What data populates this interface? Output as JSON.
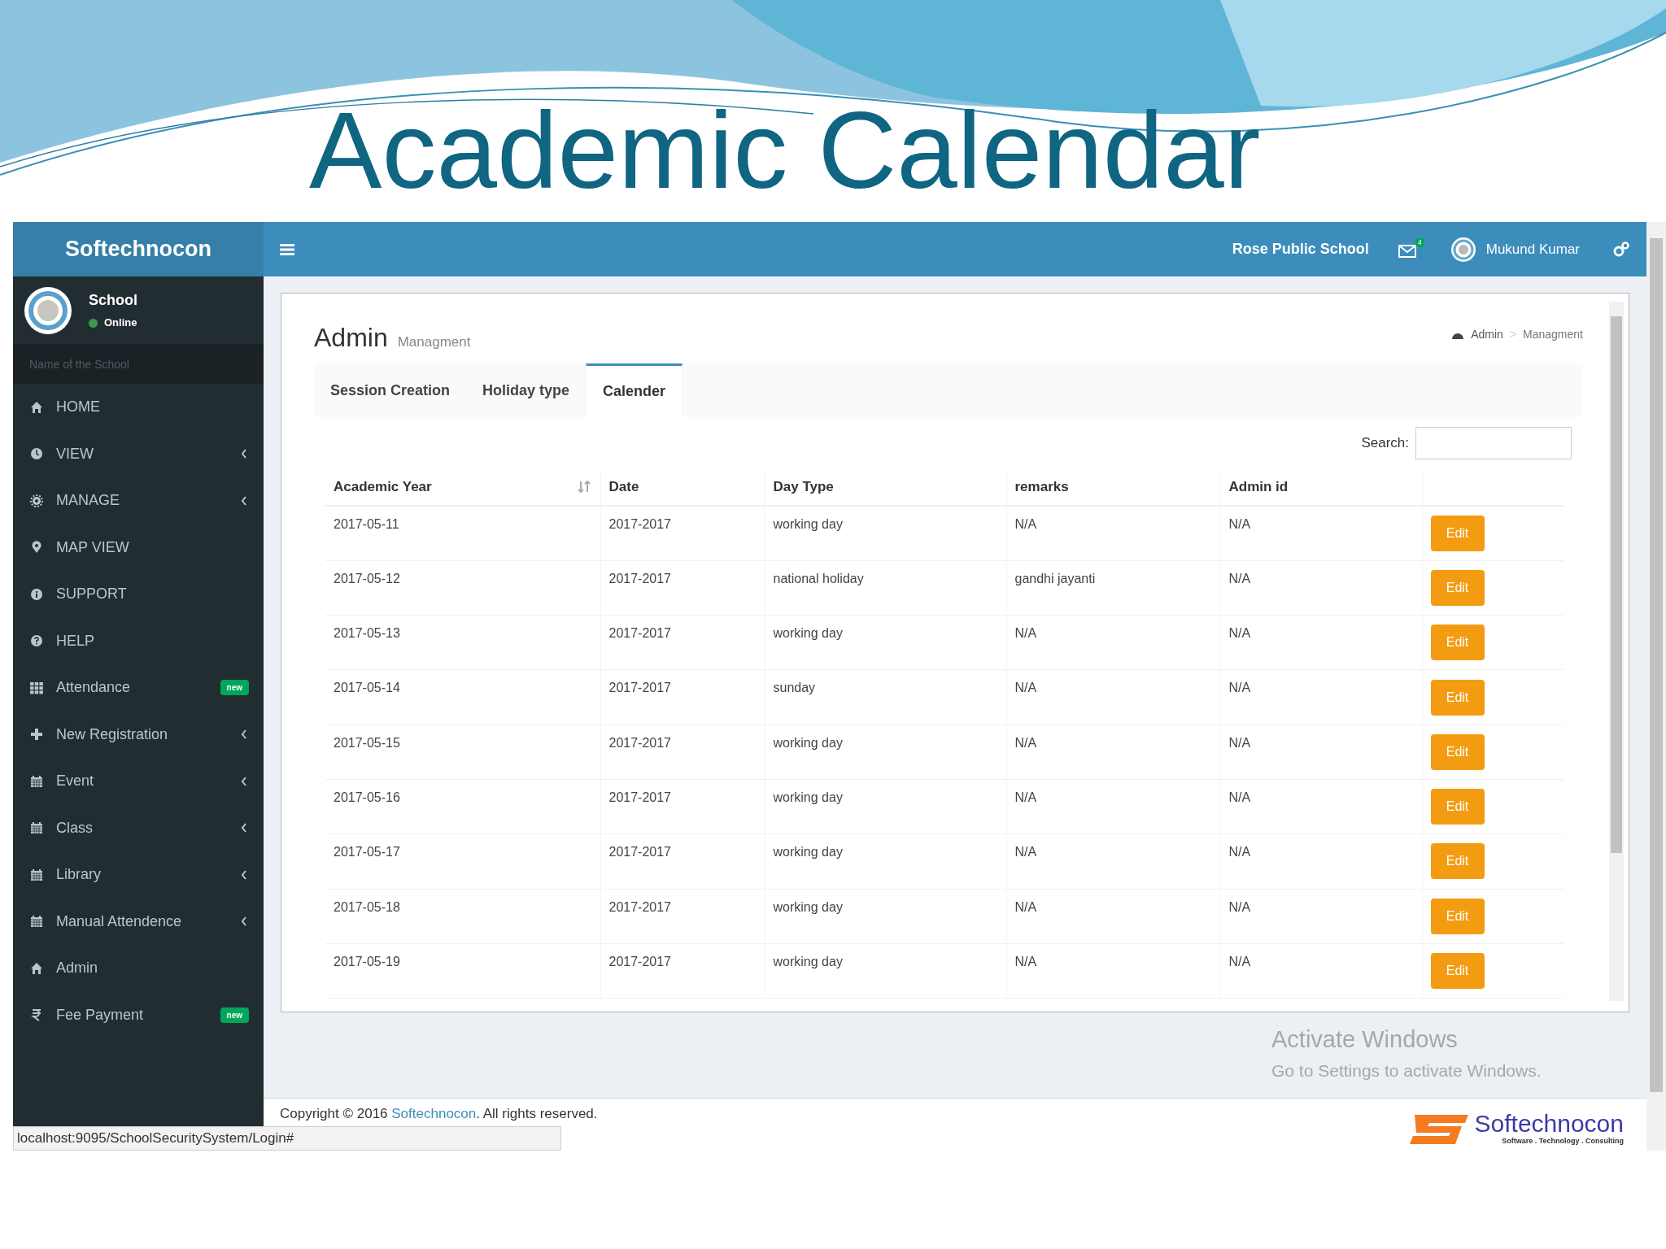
{
  "slide": {
    "title": "Academic Calendar"
  },
  "app": {
    "brand": "Softechnocon",
    "school_name": "Rose Public School",
    "mail_count": "4",
    "user_name": "Mukund Kumar"
  },
  "sidebar": {
    "user": {
      "name": "School",
      "status": "Online"
    },
    "search": {
      "placeholder": "Name of the School"
    },
    "items": [
      {
        "label": "HOME",
        "kind": "home",
        "has_submenu": false
      },
      {
        "label": "VIEW",
        "kind": "clock",
        "has_submenu": true
      },
      {
        "label": "MANAGE",
        "kind": "gear",
        "has_submenu": true
      },
      {
        "label": "MAP VIEW",
        "kind": "pin",
        "has_submenu": false
      },
      {
        "label": "SUPPORT",
        "kind": "info",
        "has_submenu": false
      },
      {
        "label": "HELP",
        "kind": "question",
        "has_submenu": false
      },
      {
        "label": "Attendance",
        "kind": "grid",
        "has_submenu": false,
        "badge": "new"
      },
      {
        "label": "New Registration",
        "kind": "plus",
        "has_submenu": true
      },
      {
        "label": "Event",
        "kind": "calendar",
        "has_submenu": true
      },
      {
        "label": "Class",
        "kind": "calendar",
        "has_submenu": true
      },
      {
        "label": "Library",
        "kind": "calendar",
        "has_submenu": true
      },
      {
        "label": "Manual Attendence",
        "kind": "calendar",
        "has_submenu": true
      },
      {
        "label": "Admin",
        "kind": "home",
        "has_submenu": false
      },
      {
        "label": "Fee Payment",
        "kind": "rupee",
        "has_submenu": false,
        "badge": "new"
      }
    ]
  },
  "page": {
    "title": "Admin",
    "subtitle": "Managment",
    "breadcrumb": [
      "Admin",
      "Managment"
    ],
    "breadcrumb_separator": ">"
  },
  "tabs": [
    {
      "label": "Session Creation",
      "selected": false
    },
    {
      "label": "Holiday type",
      "selected": false
    },
    {
      "label": "Calender",
      "selected": true
    }
  ],
  "search": {
    "label": "Search:"
  },
  "table": {
    "columns": [
      {
        "label": "Academic Year",
        "sort_icon": true
      },
      {
        "label": "Date",
        "sort_icon": false
      },
      {
        "label": "Day Type",
        "sort_icon": false
      },
      {
        "label": "remarks",
        "sort_icon": false
      },
      {
        "label": "Admin id",
        "sort_icon": false
      }
    ],
    "rows": [
      {
        "cells": [
          "2017-05-11",
          "2017-2017",
          "working day",
          "N/A",
          "N/A"
        ],
        "action": "Edit"
      },
      {
        "cells": [
          "2017-05-12",
          "2017-2017",
          "national holiday",
          "gandhi jayanti",
          "N/A"
        ],
        "action": "Edit"
      },
      {
        "cells": [
          "2017-05-13",
          "2017-2017",
          "working day",
          "N/A",
          "N/A"
        ],
        "action": "Edit"
      },
      {
        "cells": [
          "2017-05-14",
          "2017-2017",
          "sunday",
          "N/A",
          "N/A"
        ],
        "action": "Edit"
      },
      {
        "cells": [
          "2017-05-15",
          "2017-2017",
          "working day",
          "N/A",
          "N/A"
        ],
        "action": "Edit"
      },
      {
        "cells": [
          "2017-05-16",
          "2017-2017",
          "working day",
          "N/A",
          "N/A"
        ],
        "action": "Edit"
      },
      {
        "cells": [
          "2017-05-17",
          "2017-2017",
          "working day",
          "N/A",
          "N/A"
        ],
        "action": "Edit"
      },
      {
        "cells": [
          "2017-05-18",
          "2017-2017",
          "working day",
          "N/A",
          "N/A"
        ],
        "action": "Edit"
      },
      {
        "cells": [
          "2017-05-19",
          "2017-2017",
          "working day",
          "N/A",
          "N/A"
        ],
        "action": "Edit"
      }
    ]
  },
  "os_notice": {
    "title": "Activate Windows",
    "text": "Go to Settings to activate Windows."
  },
  "footer": {
    "copyright": "Copyright © 2016 ",
    "link": "Softechnocon",
    "rest": ". All rights reserved."
  },
  "footer_logo": {
    "name": "Softechnocon",
    "tagline": "Software . Technology . Consulting"
  },
  "status_bar": {
    "url": "localhost:9095/SchoolSecuritySystem/Login#"
  }
}
